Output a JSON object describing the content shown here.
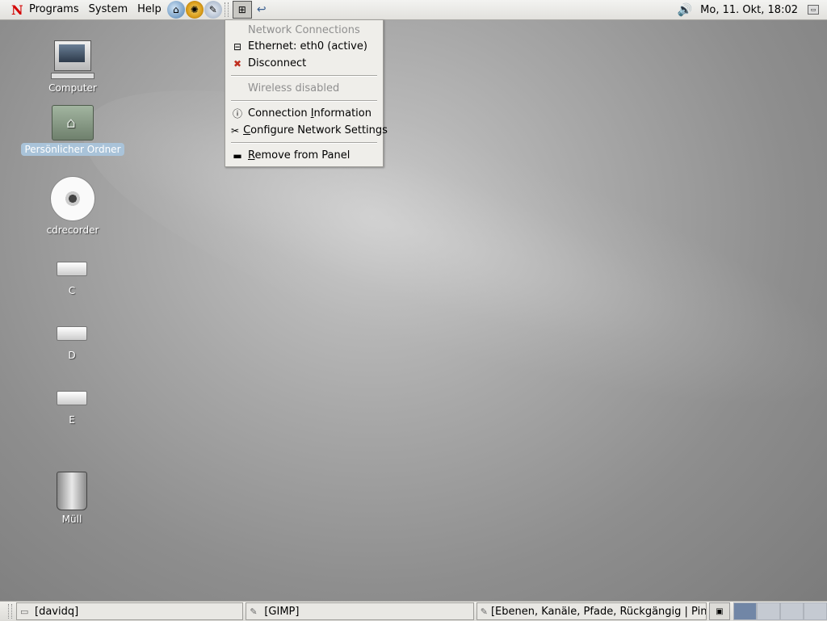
{
  "top_panel": {
    "logo": "N",
    "menus": [
      "Programs",
      "System",
      "Help"
    ],
    "clock": "Mo, 11. Okt, 18:02"
  },
  "network_menu": {
    "header": "Network Connections",
    "ethernet": "Ethernet: eth0 (active)",
    "disconnect": "Disconnect",
    "wireless": "Wireless disabled",
    "connection_info_pre": "Connection ",
    "connection_info_ul": "I",
    "connection_info_post": "nformation",
    "configure_ul": "C",
    "configure_post": "onfigure Network Settings",
    "remove_ul": "R",
    "remove_post": "emove from Panel"
  },
  "desktop_icons": [
    {
      "label": "Computer"
    },
    {
      "label": "Persönlicher Ordner"
    },
    {
      "label": "cdrecorder"
    },
    {
      "label": "C"
    },
    {
      "label": "D"
    },
    {
      "label": "E"
    },
    {
      "label": "Müll"
    }
  ],
  "taskbar": [
    {
      "label": "[davidq]"
    },
    {
      "label": "[GIMP]"
    },
    {
      "label": "[Ebenen, Kanäle, Pfade, Rückgängig | Pinsel"
    }
  ]
}
